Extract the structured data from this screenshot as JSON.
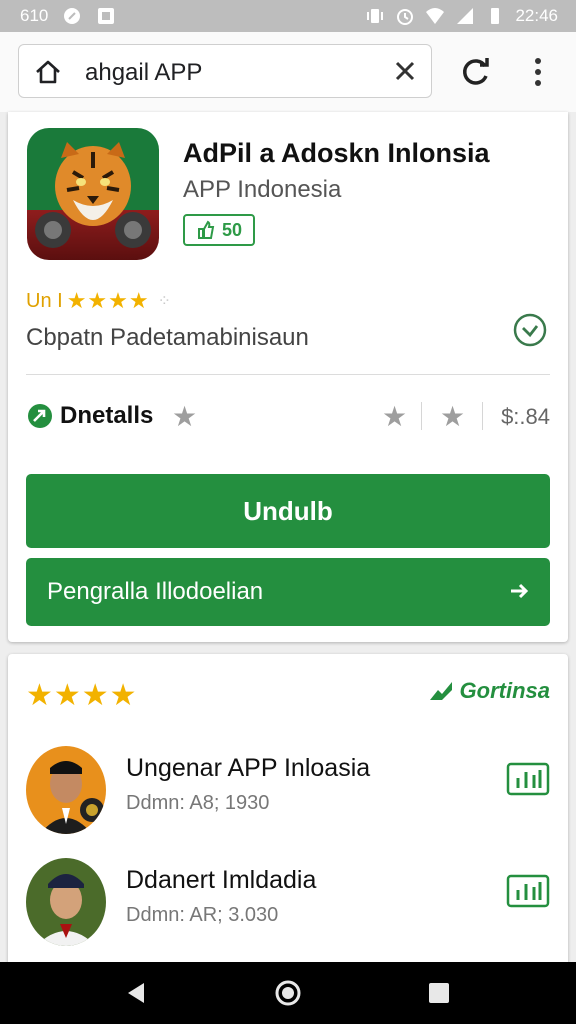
{
  "status_bar": {
    "left_text": "610",
    "time": "22:46",
    "icons": [
      "circle-icon",
      "image-icon",
      "vibrate-icon",
      "alarm-icon",
      "wifi-icon",
      "signal-icon",
      "battery-icon"
    ]
  },
  "browser": {
    "url": "ahgail  APP",
    "icons": [
      "home-icon",
      "close-icon",
      "reload-icon",
      "more-vert-icon"
    ]
  },
  "app": {
    "title": "AdPil a Adoskn Inlonsia",
    "subtitle": "APP Indonesia",
    "badge": "50",
    "rating_prefix": "Un I",
    "rating_stars": "★★★★",
    "description": "Cbpatn Padetamabinisaun",
    "details_label": "Dnetalls",
    "size_text": "$:.84",
    "primary_button": "Undulb",
    "secondary_button": "Pengralla Illodoelian"
  },
  "reviews": {
    "stars": "★★★★",
    "action_label": "Gortinsa",
    "items": [
      {
        "name": "Ungenar APP Inloasia",
        "meta": "Ddmn: A8; 1930"
      },
      {
        "name": "Ddanert Imldadia",
        "meta": "Ddmn: AR; 3.030"
      }
    ]
  },
  "colors": {
    "accent_green": "#248f3f",
    "star_yellow": "#f2b200",
    "status_bar": "#bdbdbd"
  }
}
